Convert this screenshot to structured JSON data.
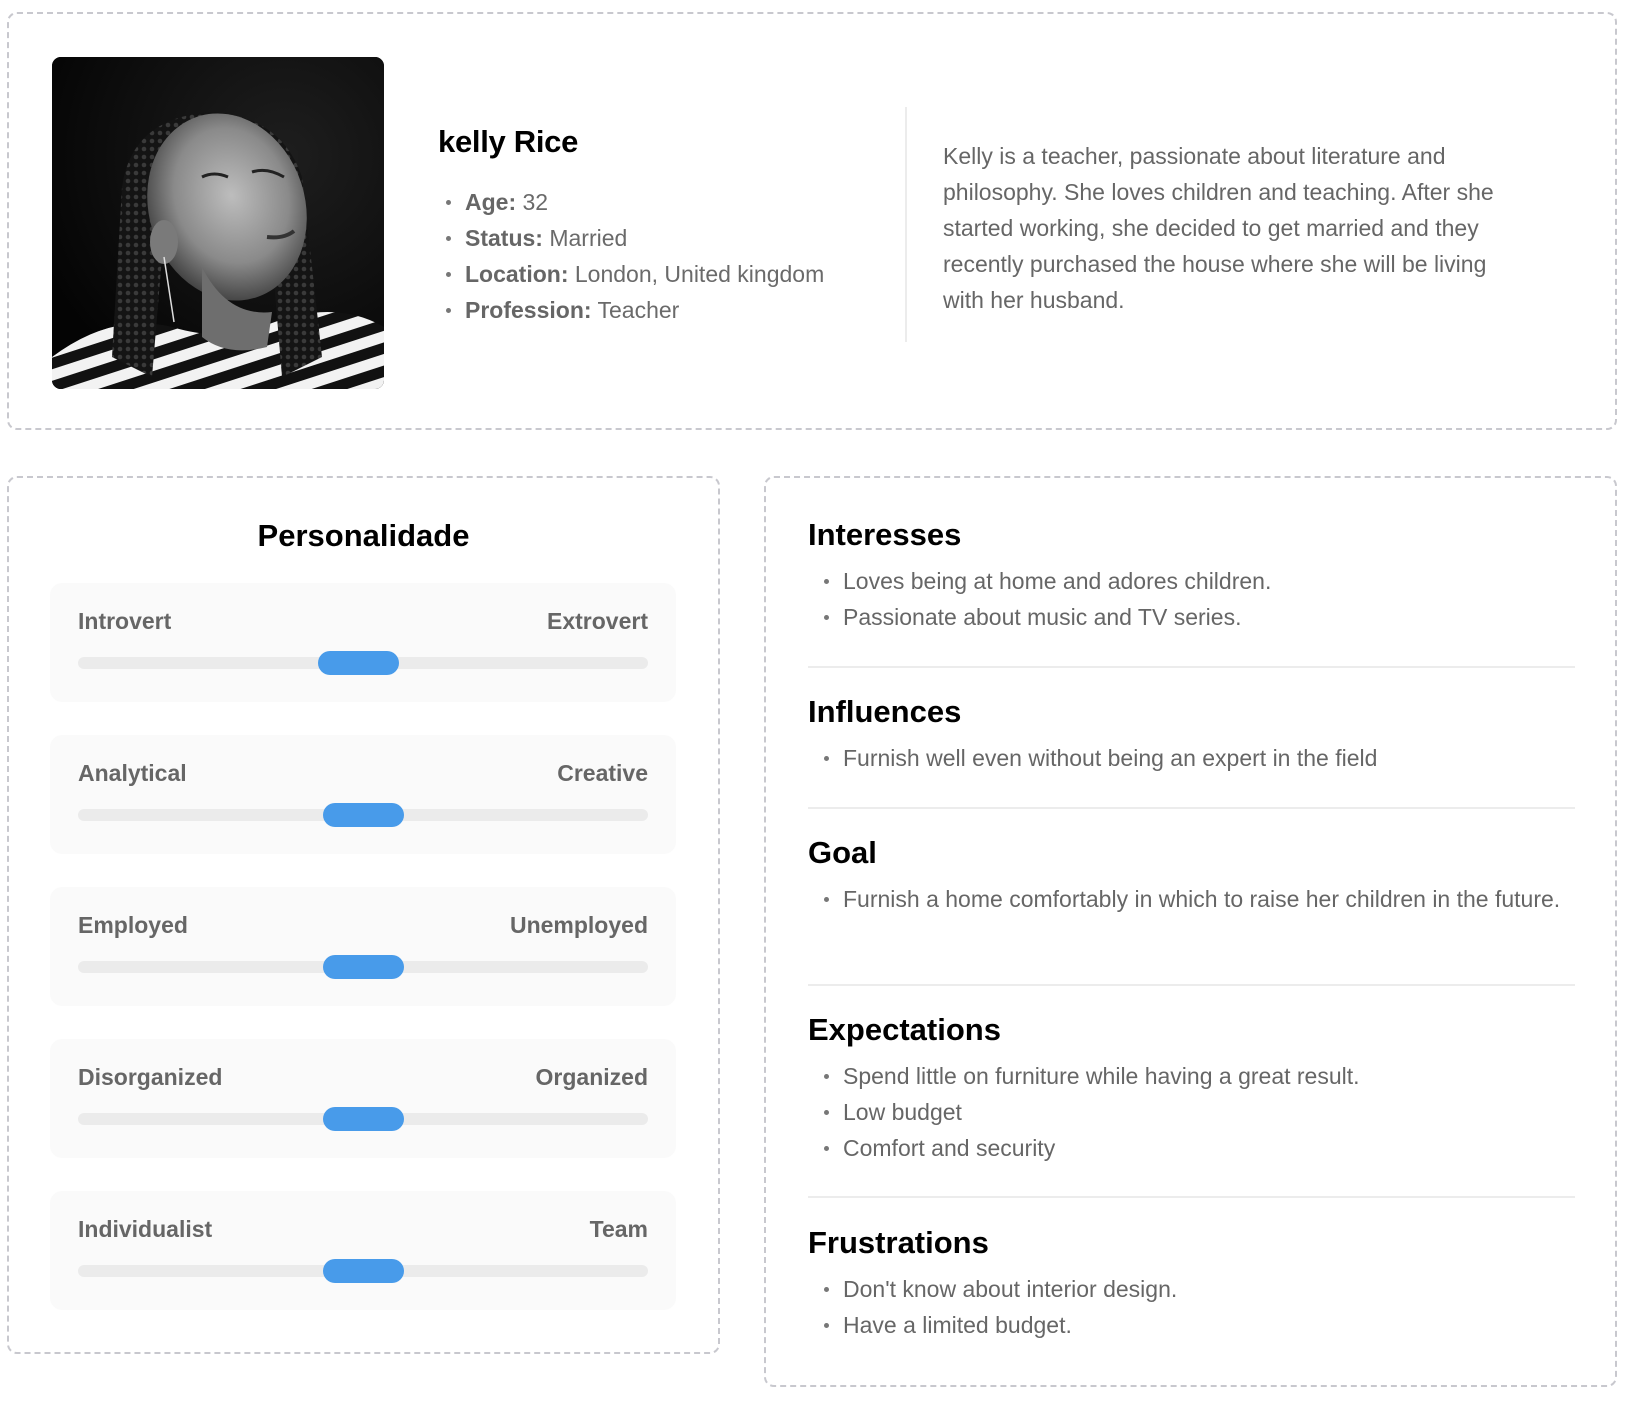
{
  "profile": {
    "photo_alt": "Portrait photo of Kelly Rice",
    "name": "kelly Rice",
    "details": [
      {
        "label": "Age:",
        "value": "32"
      },
      {
        "label": "Status:",
        "value": "Married"
      },
      {
        "label": "Location:",
        "value": "London, United kingdom"
      },
      {
        "label": "Profession:",
        "value": "Teacher"
      }
    ],
    "bio": "Kelly is a teacher, passionate about literature and philosophy. She loves children and teaching. After she started working, she decided to get married and they recently purchased the house where she will be living with her husband."
  },
  "personality": {
    "title": "Personalidade",
    "accent_color": "#489bea",
    "traits": [
      {
        "left": "Introvert",
        "right": "Extrovert",
        "value": 0.49
      },
      {
        "left": "Analytical",
        "right": "Creative",
        "value": 0.5
      },
      {
        "left": "Employed",
        "right": "Unemployed",
        "value": 0.5
      },
      {
        "left": "Disorganized",
        "right": "Organized",
        "value": 0.5
      },
      {
        "left": "Individualist",
        "right": "Team",
        "value": 0.5
      }
    ]
  },
  "sections": [
    {
      "title": "Interesses",
      "items": [
        "Loves being at home and adores children.",
        "Passionate about music and TV series."
      ]
    },
    {
      "title": "Influences",
      "items": [
        "Furnish well even without being an expert in the field"
      ]
    },
    {
      "title": "Goal",
      "items": [
        "Furnish a home comfortably in which to raise her children in the future."
      ]
    },
    {
      "title": "Expectations",
      "items": [
        "Spend little on furniture while having a great result.",
        "Low budget",
        "Comfort and security"
      ]
    },
    {
      "title": "Frustrations",
      "items": [
        "Don't know about interior design.",
        "Have a limited budget."
      ]
    }
  ]
}
